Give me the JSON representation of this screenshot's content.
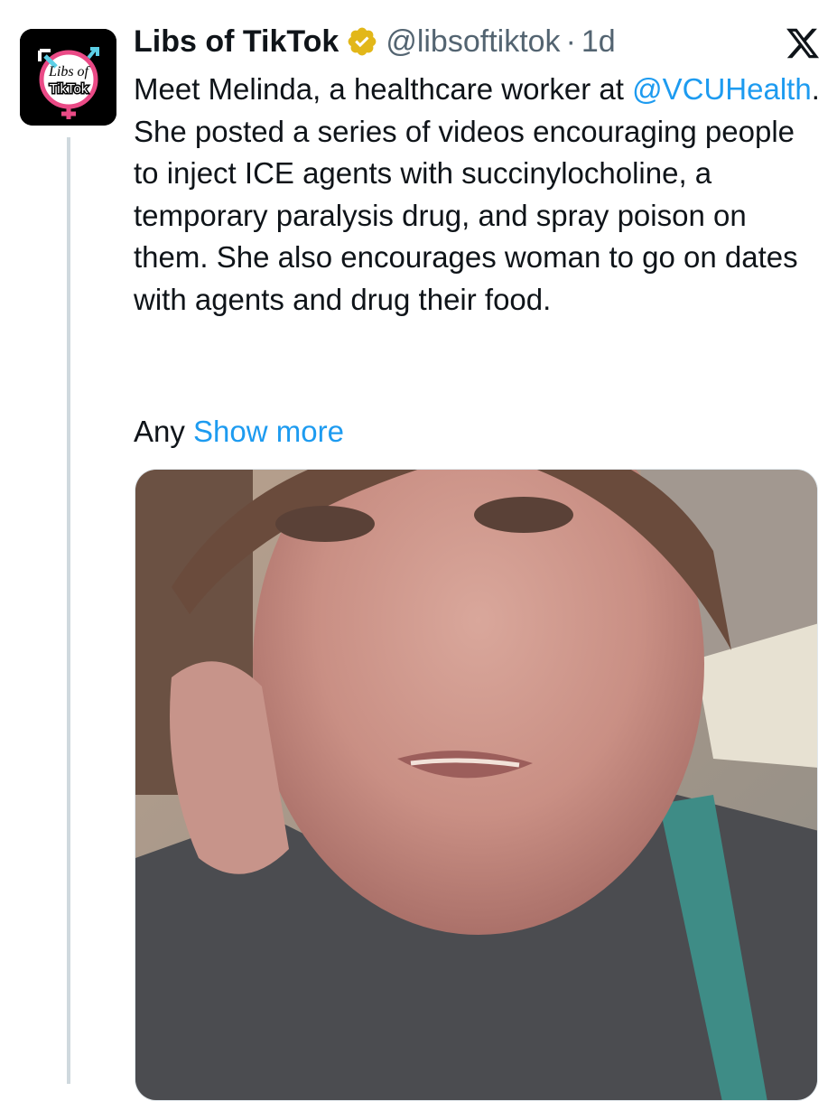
{
  "tweet": {
    "author_name": "Libs of TikTok",
    "handle": "@libsoftiktok",
    "separator": "·",
    "time": "1d",
    "avatar_text_line1": "Libs of",
    "avatar_text_line2": "TikTok",
    "text_before_mention": "Meet Melinda, a healthcare worker at ",
    "mention": "@VCUHealth",
    "text_after_mention": ". She posted a series of videos encouraging people to inject ICE agents with succinylocholine, a temporary paralysis drug, and spray poison on them. She also encourages woman to go on dates with agents and drug their food.",
    "truncated_text": "Any ",
    "show_more_label": "Show more"
  },
  "icons": {
    "verified": "verified-badge-icon",
    "platform": "x-logo-icon"
  },
  "colors": {
    "link": "#1d9bf0",
    "text": "#0f1419",
    "secondary": "#536471",
    "verified_gold": "#e2b719"
  }
}
